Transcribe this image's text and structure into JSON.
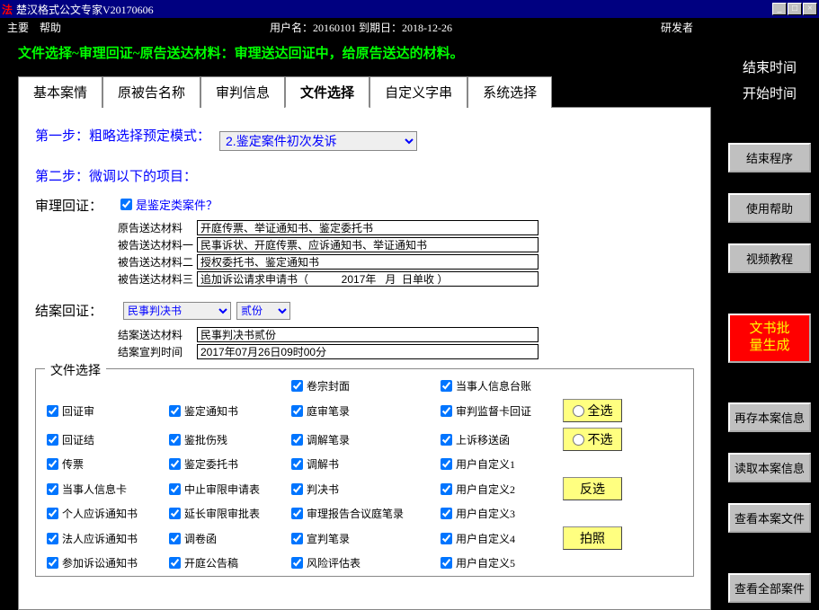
{
  "window": {
    "icon": "法",
    "title": "楚汉格式公文专家V20170606",
    "min": "_",
    "max": "□",
    "close": "×"
  },
  "menu": {
    "main": "主要",
    "help": "帮助",
    "user_label": "用户名：20160101    到期日：2018-12-26",
    "dev": "研发者"
  },
  "hint": "文件选择~审理回证~原告送达材料：审理送达回证中，给原告送达的材料。",
  "tabs": [
    "基本案情",
    "原被告名称",
    "审判信息",
    "文件选择",
    "自定义字串",
    "系统选择"
  ],
  "active_tab": 3,
  "step1": {
    "label": "第一步：粗略选择预定模式：",
    "value": "2.鉴定案件初次发诉"
  },
  "step2": {
    "label": "第二步：微调以下的项目："
  },
  "trial": {
    "section": "审理回证：",
    "chk_label": "是鉴定类案件？",
    "rows": [
      {
        "label": "原告送达材料",
        "value": "开庭传票、举证通知书、鉴定委托书"
      },
      {
        "label": "被告送达材料一",
        "value": "民事诉状、开庭传票、应诉通知书、举证通知书"
      },
      {
        "label": "被告送达材料二",
        "value": "授权委托书、鉴定通知书"
      },
      {
        "label": "被告送达材料三",
        "value": "追加诉讼请求申请书（           2017年   月  日单收 ）"
      }
    ]
  },
  "close_case": {
    "section": "结案回证：",
    "combo1": "民事判决书",
    "combo2": "贰份",
    "rows": [
      {
        "label": "结案送达材料",
        "value": "民事判决书贰份"
      },
      {
        "label": "结案宣判时间",
        "value": "2017年07月26日09时00分"
      }
    ]
  },
  "file_select": {
    "legend": "文件选择",
    "grid": [
      [
        "",
        "",
        "卷宗封面",
        "当事人信息台账",
        ""
      ],
      [
        "回证审",
        "鉴定通知书",
        "庭审笔录",
        "审判监督卡回证",
        "全选"
      ],
      [
        "回证结",
        "鉴批伤残",
        "调解笔录",
        "上诉移送函",
        "不选"
      ],
      [
        "传票",
        "鉴定委托书",
        "调解书",
        "用户自定义1",
        ""
      ],
      [
        "当事人信息卡",
        "中止审限申请表",
        "判决书",
        "用户自定义2",
        "反选"
      ],
      [
        "个人应诉通知书",
        "延长审限审批表",
        "审理报告合议庭笔录",
        "用户自定义3",
        ""
      ],
      [
        "法人应诉通知书",
        "调卷函",
        "宣判笔录",
        "用户自定义4",
        "拍照"
      ],
      [
        "参加诉讼通知书",
        "开庭公告稿",
        "风险评估表",
        "用户自定义5",
        ""
      ]
    ]
  },
  "sidebar": {
    "time1": "结束时间",
    "time2": "开始时间",
    "buttons": {
      "end": "结束程序",
      "help": "使用帮助",
      "video": "视频教程",
      "generate": "文书批\n量生成",
      "resave": "再存本案信息",
      "load": "读取本案信息",
      "viewfiles": "查看本案文件",
      "viewall": "查看全部案件"
    }
  }
}
